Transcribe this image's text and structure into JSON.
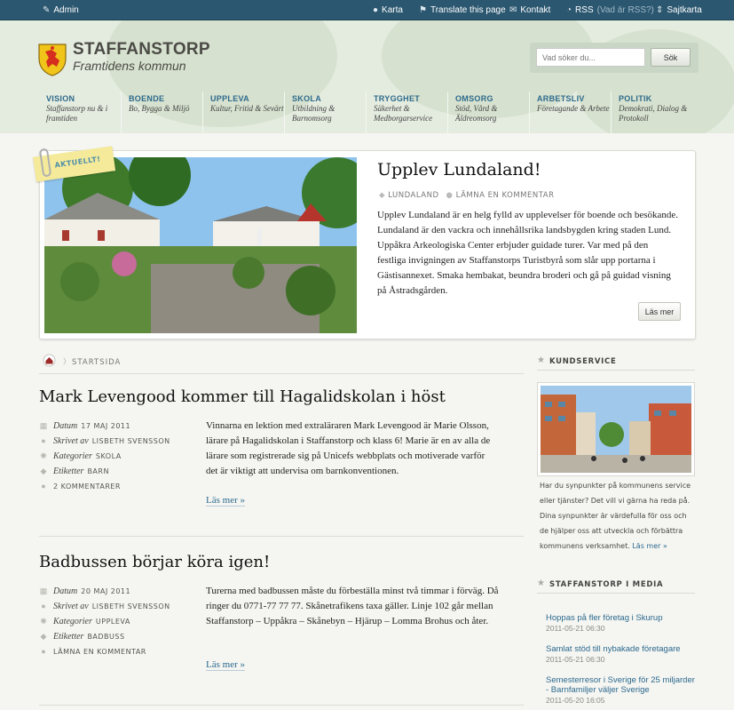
{
  "topbar": {
    "admin": "Admin",
    "karta": "Karta",
    "translate": "Translate this page",
    "kontakt": "Kontakt",
    "rss": "RSS",
    "rss_note": "(Vad är RSS?)",
    "sajtkarta": "Sajtkarta"
  },
  "logo": {
    "title": "STAFFANSTORP",
    "subtitle": "Framtidens kommun"
  },
  "search": {
    "placeholder": "Vad söker du...",
    "button": "Sök"
  },
  "nav": [
    {
      "title": "VISION",
      "sub": "Staffanstorp nu & i framtiden"
    },
    {
      "title": "BOENDE",
      "sub": "Bo, Bygga & Miljö"
    },
    {
      "title": "UPPLEVA",
      "sub": "Kultur, Fritid & Sevärt"
    },
    {
      "title": "SKOLA",
      "sub": "Utbildning & Barnomsorg"
    },
    {
      "title": "TRYGGHET",
      "sub": "Säkerhet & Medborgarservice"
    },
    {
      "title": "OMSORG",
      "sub": "Stöd, Vård & Äldreomsorg"
    },
    {
      "title": "ARBETSLIV",
      "sub": "Företagande & Arbete"
    },
    {
      "title": "POLITIK",
      "sub": "Demokrati, Dialog & Protokoll"
    }
  ],
  "featured": {
    "badge": "AKTUELLT!",
    "title": "Upplev Lundaland!",
    "tag": "LUNDALAND",
    "comment": "LÄMNA EN KOMMENTAR",
    "text": "Upplev Lundaland är en helg fylld av upplevelser för boende och besökande. Lundaland är den vackra och innehållsrika landsbygden kring staden Lund. Uppåkra Arkeologiska Center erbjuder guidade turer. Var med på den festliga invigningen av Staffanstorps Turistbyrå som slår upp portarna i Gästisannexet. Smaka hembakat, beundra broderi och gå på guidad visning på Åstradsgården.",
    "more": "Läs mer"
  },
  "breadcrumb": {
    "current": "STARTSIDA"
  },
  "posts": [
    {
      "title": "Mark Levengood kommer till Hagalidskolan i höst",
      "date_label": "Datum",
      "date": "17 MAJ 2011",
      "author_label": "Skrivet av",
      "author": "LISBETH SVENSSON",
      "category_label": "Kategorier",
      "category": "SKOLA",
      "tags_label": "Etiketter",
      "tags": "BARN",
      "comments": "2 KOMMENTARER",
      "text": "Vinnarna en lektion med extraläraren Mark Levengood är Marie Olsson, lärare på Hagalidskolan i Staffanstorp och klass 6! Marie är en av alla de lärare som registrerade sig på Unicefs webbplats och motiverade varför det är viktigt att undervisa om barnkonventionen.",
      "more": "Läs mer »"
    },
    {
      "title": "Badbussen börjar köra igen!",
      "date_label": "Datum",
      "date": "20 MAJ 2011",
      "author_label": "Skrivet av",
      "author": "LISBETH SVENSSON",
      "category_label": "Kategorier",
      "category": "UPPLEVA",
      "tags_label": "Etiketter",
      "tags": "BADBUSS",
      "comments": "LÄMNA EN KOMMENTAR",
      "text": "Turerna med badbussen måste du förbeställa minst två timmar i förväg. Då ringer du 0771-77 77 77. Skånetrafikens taxa gäller. Linje 102 går mellan Staffanstorp – Uppåkra – Skånebyn – Hjärup – Lomma Brohus och åter.",
      "more": "Läs mer »"
    }
  ],
  "sidebar": {
    "kundservice_title": "KUNDSERVICE",
    "kundservice_text": "Har du synpunkter på kommunens service eller tjänster? Det vill vi gärna ha reda på. Dina synpunkter är värdefulla för oss och de hjälper oss att utveckla och förbättra kommunens verksamhet.",
    "kundservice_link": "Läs mer »",
    "media_title": "STAFFANSTORP I MEDIA",
    "media": [
      {
        "title": "Hoppas på fler företag i Skurup",
        "date": "2011-05-21 06:30"
      },
      {
        "title": "Samlat stöd till nybakade företagare",
        "date": "2011-05-21 06:30"
      },
      {
        "title": "Semesterresor i Sverige för 25 miljarder - Barnfamiljer väljer Sverige",
        "date": "2011-05-20 16:05"
      }
    ]
  },
  "colors": {
    "topbar": "#2b5770",
    "accent": "#2d6a8b",
    "header_bg": "#e4ebdf",
    "badge": "#f4ea9a"
  }
}
